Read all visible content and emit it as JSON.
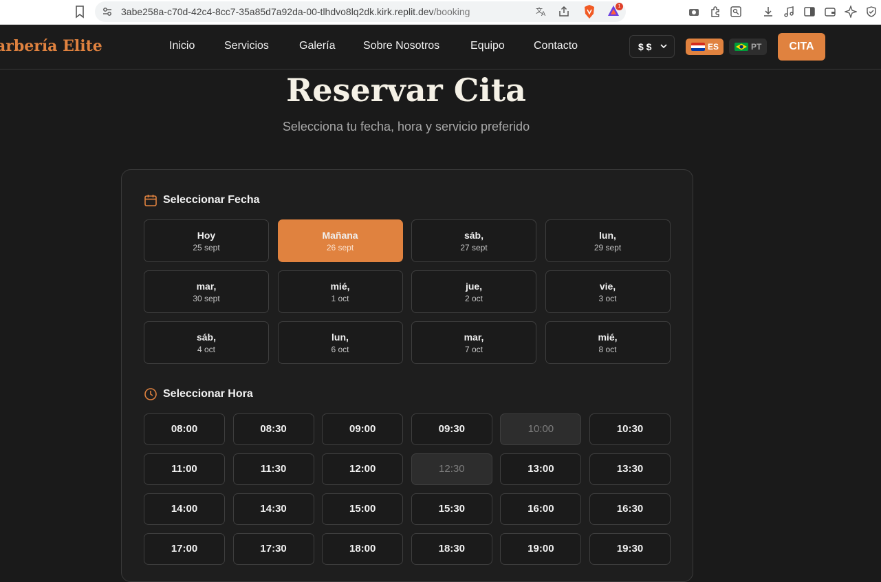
{
  "browser": {
    "url_host": "3abe258a-c70d-42c4-8cc7-35a85d7a92da-00-tlhdvo8lq2dk.kirk.replit.dev",
    "url_path": "/booking",
    "rewards_badge": "1"
  },
  "header": {
    "logo": "arbería Elite",
    "nav": [
      "Inicio",
      "Servicios",
      "Galería",
      "Sobre Nosotros",
      "Equipo",
      "Contacto"
    ],
    "currency": "$ $",
    "lang_es": "ES",
    "lang_pt": "PT",
    "cta": "CITA"
  },
  "page": {
    "title": "Reservar Cita",
    "subtitle": "Selecciona tu fecha, hora y servicio preferido"
  },
  "date_section": {
    "heading": "Seleccionar Fecha",
    "dates": [
      {
        "day": "Hoy",
        "date": "25 sept",
        "selected": false
      },
      {
        "day": "Mañana",
        "date": "26 sept",
        "selected": true
      },
      {
        "day": "sáb,",
        "date": "27 sept",
        "selected": false
      },
      {
        "day": "lun,",
        "date": "29 sept",
        "selected": false
      },
      {
        "day": "mar,",
        "date": "30 sept",
        "selected": false
      },
      {
        "day": "mié,",
        "date": "1 oct",
        "selected": false
      },
      {
        "day": "jue,",
        "date": "2 oct",
        "selected": false
      },
      {
        "day": "vie,",
        "date": "3 oct",
        "selected": false
      },
      {
        "day": "sáb,",
        "date": "4 oct",
        "selected": false
      },
      {
        "day": "lun,",
        "date": "6 oct",
        "selected": false
      },
      {
        "day": "mar,",
        "date": "7 oct",
        "selected": false
      },
      {
        "day": "mié,",
        "date": "8 oct",
        "selected": false
      }
    ]
  },
  "time_section": {
    "heading": "Seleccionar Hora",
    "times": [
      {
        "t": "08:00",
        "available": true
      },
      {
        "t": "08:30",
        "available": true
      },
      {
        "t": "09:00",
        "available": true
      },
      {
        "t": "09:30",
        "available": true
      },
      {
        "t": "10:00",
        "available": false
      },
      {
        "t": "10:30",
        "available": true
      },
      {
        "t": "11:00",
        "available": true
      },
      {
        "t": "11:30",
        "available": true
      },
      {
        "t": "12:00",
        "available": true
      },
      {
        "t": "12:30",
        "available": false
      },
      {
        "t": "13:00",
        "available": true
      },
      {
        "t": "13:30",
        "available": true
      },
      {
        "t": "14:00",
        "available": true
      },
      {
        "t": "14:30",
        "available": true
      },
      {
        "t": "15:00",
        "available": true
      },
      {
        "t": "15:30",
        "available": true
      },
      {
        "t": "16:00",
        "available": true
      },
      {
        "t": "16:30",
        "available": true
      },
      {
        "t": "17:00",
        "available": true
      },
      {
        "t": "17:30",
        "available": true
      },
      {
        "t": "18:00",
        "available": true
      },
      {
        "t": "18:30",
        "available": true
      },
      {
        "t": "19:00",
        "available": true
      },
      {
        "t": "19:30",
        "available": true
      }
    ]
  }
}
